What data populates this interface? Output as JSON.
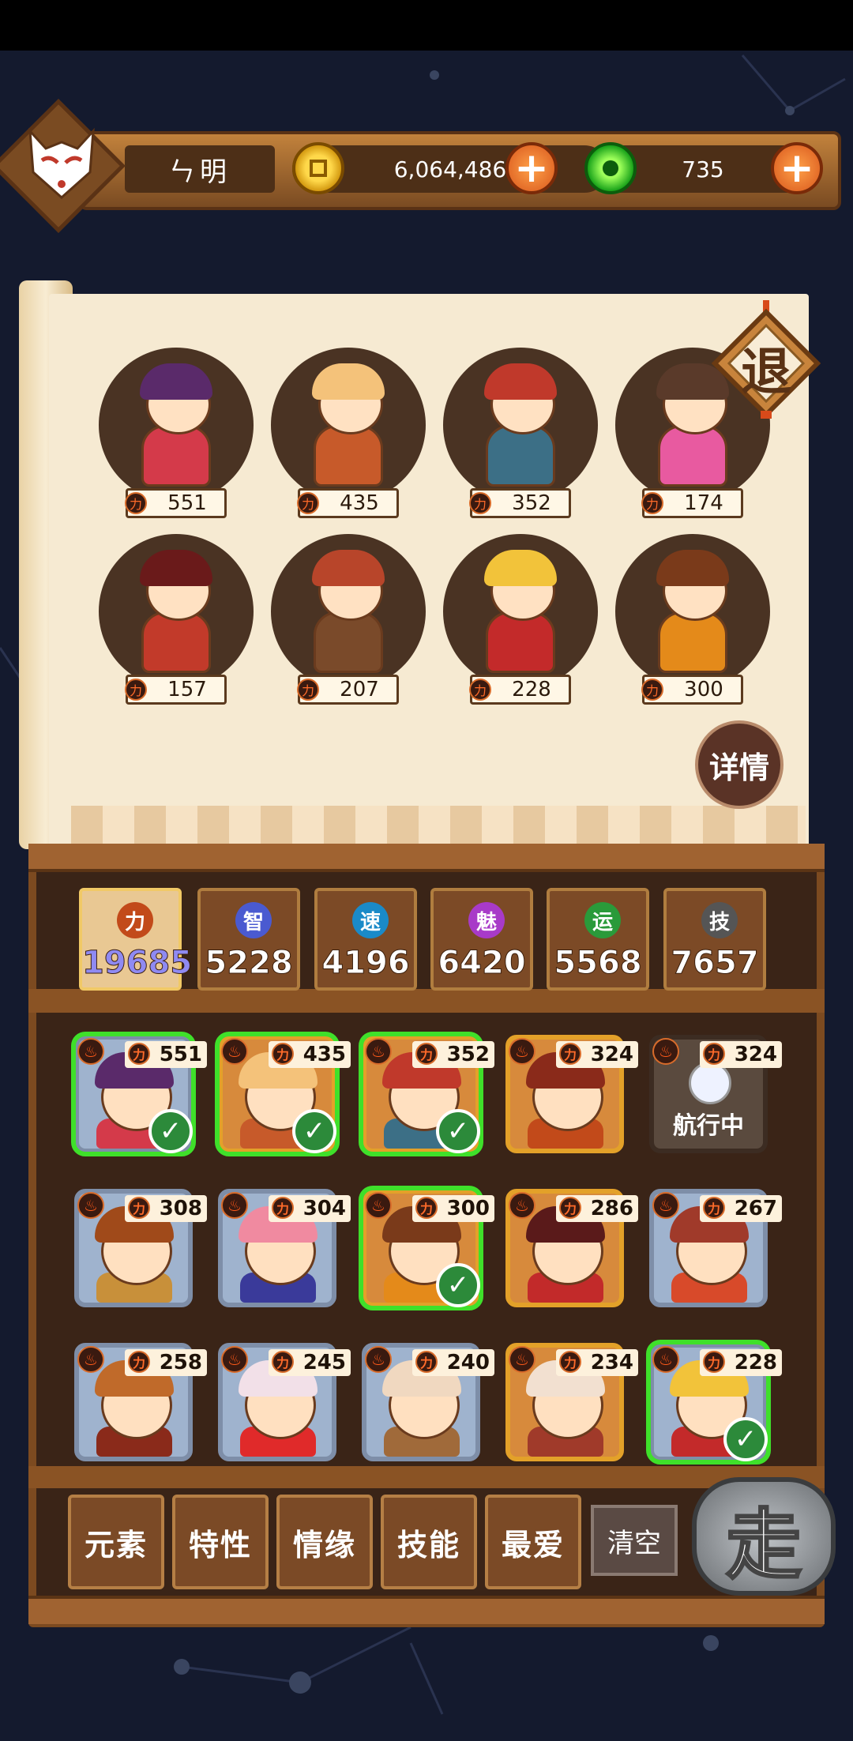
{
  "player": {
    "name": "ㄣ明"
  },
  "currency": {
    "coins": "6,064,486",
    "gems": "735"
  },
  "buttons": {
    "exit": "退",
    "details": "详情",
    "go": "走",
    "clear": "清空",
    "plus": "+"
  },
  "team": [
    {
      "power": "551",
      "hair": "#5a2a6a",
      "body": "#d43a4a"
    },
    {
      "power": "435",
      "hair": "#f4c27a",
      "body": "#c75a2a"
    },
    {
      "power": "352",
      "hair": "#c0392b",
      "body": "#3c6f86"
    },
    {
      "power": "174",
      "hair": "#5a3a2a",
      "body": "#e85aa0"
    },
    {
      "power": "157",
      "hair": "#6a1a1a",
      "body": "#c23a2a"
    },
    {
      "power": "207",
      "hair": "#b8452a",
      "body": "#7a4a2a"
    },
    {
      "power": "228",
      "hair": "#f2c33a",
      "body": "#c32a2a"
    },
    {
      "power": "300",
      "hair": "#7a3a1a",
      "body": "#e48a1a"
    }
  ],
  "attributes": [
    {
      "icon": "力",
      "value": "19685",
      "color": "#c24a1a",
      "active": true
    },
    {
      "icon": "智",
      "value": "5228",
      "color": "#4a5ad0",
      "active": false
    },
    {
      "icon": "速",
      "value": "4196",
      "color": "#1a8ac8",
      "active": false
    },
    {
      "icon": "魅",
      "value": "6420",
      "color": "#a83ac8",
      "active": false
    },
    {
      "icon": "运",
      "value": "5568",
      "color": "#2a9a3a",
      "active": false
    },
    {
      "icon": "技",
      "value": "7657",
      "color": "#555555",
      "active": false
    }
  ],
  "roster": [
    {
      "power": "551",
      "frame": "blue",
      "selected": true,
      "hair": "#5a2a6a",
      "body": "#d43a4a"
    },
    {
      "power": "435",
      "frame": "gold",
      "selected": true,
      "hair": "#f4c27a",
      "body": "#c75a2a"
    },
    {
      "power": "352",
      "frame": "gold",
      "selected": true,
      "hair": "#c0392b",
      "body": "#3c6f86"
    },
    {
      "power": "324",
      "frame": "gold",
      "selected": false,
      "hair": "#8a2a1a",
      "body": "#c24a1a"
    },
    {
      "power": "324",
      "frame": "dark",
      "selected": false,
      "sailing": "航行中",
      "hair": "#6a5a4a",
      "body": "#8a6a4a"
    },
    {
      "power": "308",
      "frame": "blue",
      "selected": false,
      "hair": "#a04a1a",
      "body": "#c8903a"
    },
    {
      "power": "304",
      "frame": "blue",
      "selected": false,
      "hair": "#f08aa0",
      "body": "#3a3a9a"
    },
    {
      "power": "300",
      "frame": "gold",
      "selected": true,
      "hair": "#7a3a1a",
      "body": "#e48a1a"
    },
    {
      "power": "286",
      "frame": "gold",
      "selected": false,
      "hair": "#5a1a1a",
      "body": "#c22a2a"
    },
    {
      "power": "267",
      "frame": "blue",
      "selected": false,
      "hair": "#a03a2a",
      "body": "#d84a2a"
    },
    {
      "power": "258",
      "frame": "blue",
      "selected": false,
      "hair": "#c06a2a",
      "body": "#8a2a1a"
    },
    {
      "power": "245",
      "frame": "blue",
      "selected": false,
      "hair": "#f2e0e8",
      "body": "#e02a2a"
    },
    {
      "power": "240",
      "frame": "blue",
      "selected": false,
      "hair": "#f0d8c0",
      "body": "#a06a3a"
    },
    {
      "power": "234",
      "frame": "gold",
      "selected": false,
      "hair": "#f2e0d0",
      "body": "#a03a2a"
    },
    {
      "power": "228",
      "frame": "blue",
      "selected": true,
      "hair": "#f2c33a",
      "body": "#c32a2a"
    }
  ],
  "filters": [
    "元素",
    "特性",
    "情缘",
    "技能",
    "最爱"
  ]
}
